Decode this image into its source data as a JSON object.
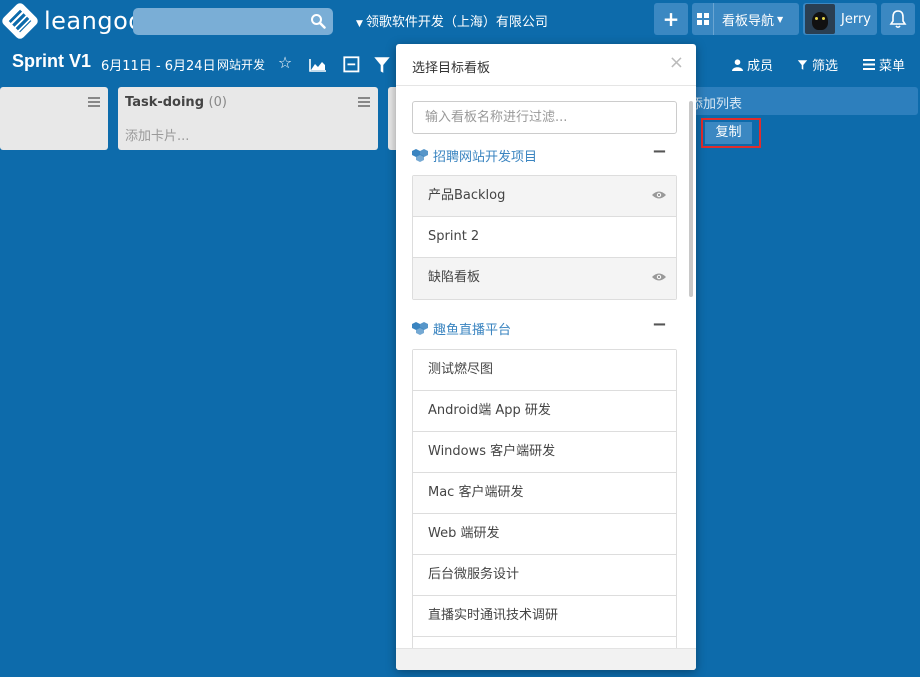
{
  "topbar": {
    "logo_text": "leangoo",
    "search_placeholder": "",
    "org_name": "领歌软件开发（上海）有限公司",
    "add_label": "+",
    "board_nav_label": "看板导航",
    "user_name": "Jerry"
  },
  "board": {
    "title": "Sprint V1",
    "dates": "6月11日 - 6月24日",
    "project": "网站开发",
    "members_label": "成员",
    "filter_label": "筛选",
    "menu_label": "菜单"
  },
  "columns": [
    {
      "name": "",
      "count": "",
      "add_card": ""
    },
    {
      "name": "Task-doing",
      "count": "(0)",
      "add_card": "添加卡片..."
    }
  ],
  "add_list_label": "添加列表",
  "copy_label": "复制",
  "modal": {
    "title": "选择目标看板",
    "close": "×",
    "filter_placeholder": "输入看板名称进行过滤...",
    "groups": [
      {
        "name": "招聘网站开发项目",
        "collapse": "−",
        "boards": [
          {
            "name": "产品Backlog",
            "watched": true
          },
          {
            "name": "Sprint 2",
            "watched": false
          },
          {
            "name": "缺陷看板",
            "watched": true
          }
        ]
      },
      {
        "name": "趣鱼直播平台",
        "collapse": "−",
        "boards": [
          {
            "name": "测试燃尽图"
          },
          {
            "name": "Android端 App 研发"
          },
          {
            "name": "Windows 客户端研发"
          },
          {
            "name": "Mac 客户端研发"
          },
          {
            "name": "Web 端研发"
          },
          {
            "name": "后台微服务设计"
          },
          {
            "name": "直播实时通讯技术调研"
          }
        ]
      }
    ]
  },
  "colors": {
    "background": "#0d6bab",
    "accent": "#3a84c0",
    "highlight": "#e02d2d"
  }
}
